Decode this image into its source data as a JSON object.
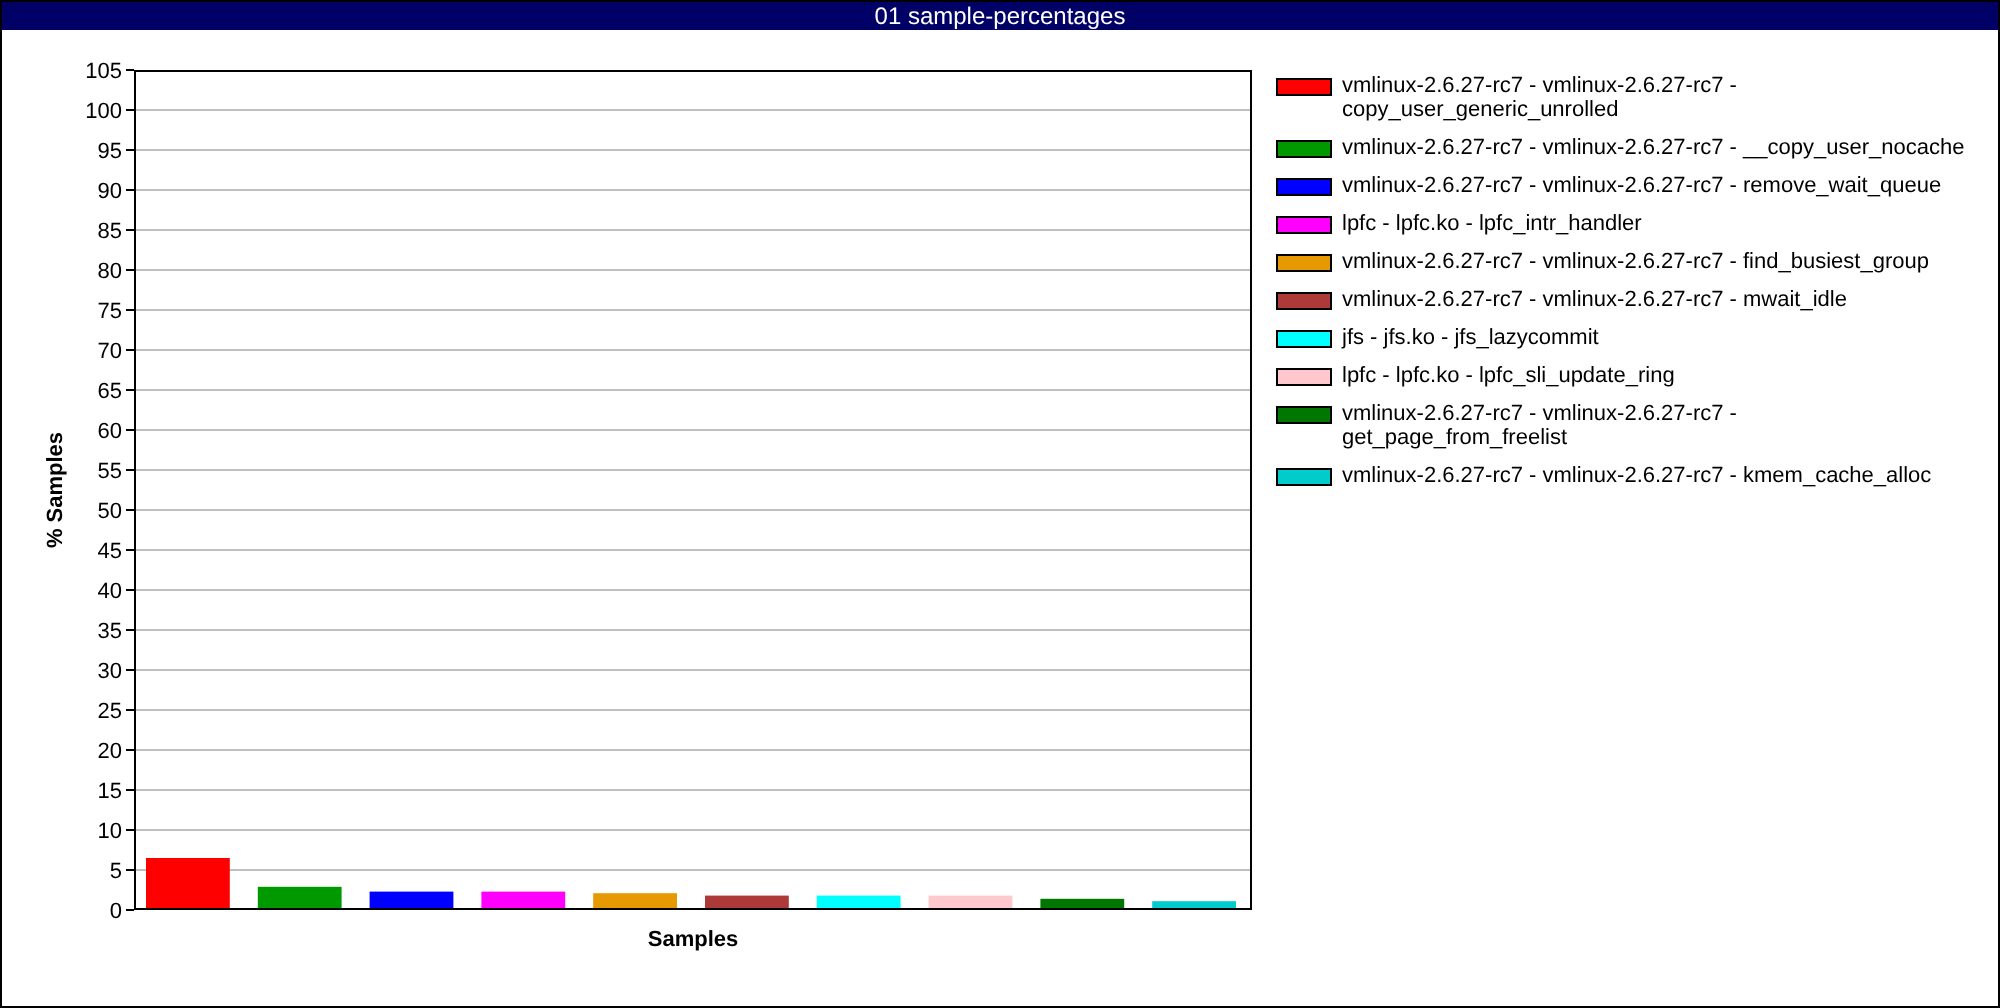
{
  "window": {
    "title": "01 sample-percentages"
  },
  "chart": {
    "chart_data": {
      "type": "bar",
      "xlabel": "Samples",
      "ylabel": "% Samples",
      "ylim": [
        0,
        105
      ],
      "grid": true,
      "yticks": [
        0,
        5,
        10,
        15,
        20,
        25,
        30,
        35,
        40,
        45,
        50,
        55,
        60,
        65,
        70,
        75,
        80,
        85,
        90,
        95,
        100,
        105
      ],
      "series": [
        {
          "name": "vmlinux-2.6.27-rc7 - vmlinux-2.6.27-rc7 - copy_user_generic_unrolled",
          "color": "#ff0000",
          "values": [
            6.5
          ]
        },
        {
          "name": "vmlinux-2.6.27-rc7 - vmlinux-2.6.27-rc7 - __copy_user_nocache",
          "color": "#009900",
          "values": [
            2.9
          ]
        },
        {
          "name": "vmlinux-2.6.27-rc7 - vmlinux-2.6.27-rc7 - remove_wait_queue",
          "color": "#0000ff",
          "values": [
            2.3
          ]
        },
        {
          "name": "lpfc - lpfc.ko - lpfc_intr_handler",
          "color": "#ff00ff",
          "values": [
            2.3
          ]
        },
        {
          "name": "vmlinux-2.6.27-rc7 - vmlinux-2.6.27-rc7 - find_busiest_group",
          "color": "#e69900",
          "values": [
            2.1
          ]
        },
        {
          "name": "vmlinux-2.6.27-rc7 - vmlinux-2.6.27-rc7 - mwait_idle",
          "color": "#ad3939",
          "values": [
            1.8
          ]
        },
        {
          "name": "jfs - jfs.ko - jfs_lazycommit",
          "color": "#00ffff",
          "values": [
            1.8
          ]
        },
        {
          "name": "lpfc - lpfc.ko - lpfc_sli_update_ring",
          "color": "#ffc8cc",
          "values": [
            1.8
          ]
        },
        {
          "name": "vmlinux-2.6.27-rc7 - vmlinux-2.6.27-rc7 - get_page_from_freelist",
          "color": "#007700",
          "values": [
            1.4
          ]
        },
        {
          "name": "vmlinux-2.6.27-rc7 - vmlinux-2.6.27-rc7 - kmem_cache_alloc",
          "color": "#00cccc",
          "values": [
            1.1
          ]
        }
      ]
    }
  }
}
